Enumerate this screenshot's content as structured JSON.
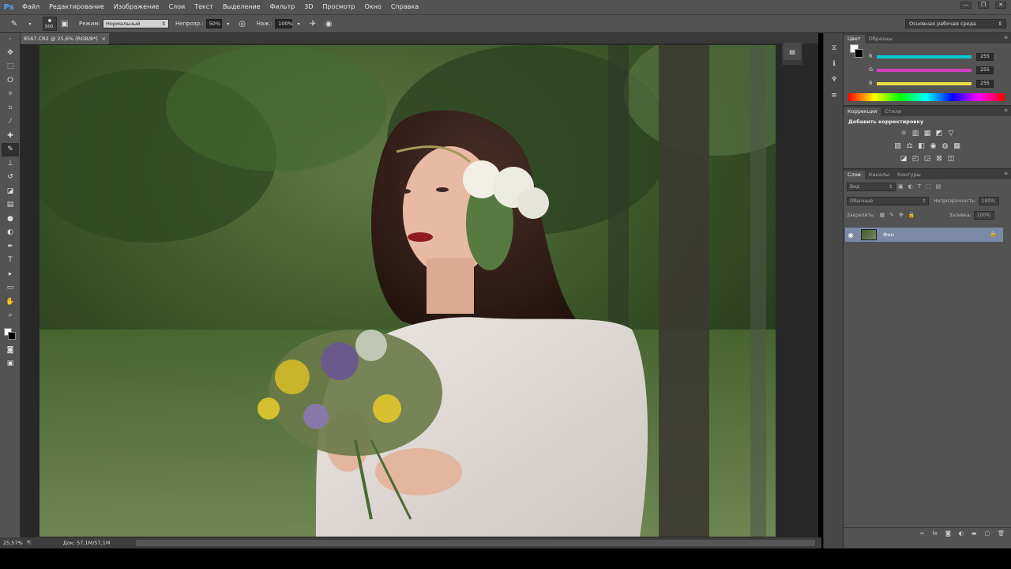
{
  "app": {
    "logo": "Ps"
  },
  "menu": [
    "Файл",
    "Редактирование",
    "Изображение",
    "Слои",
    "Текст",
    "Выделение",
    "Фильтр",
    "3D",
    "Просмотр",
    "Окно",
    "Справка"
  ],
  "window_controls": {
    "minimize": "—",
    "restore": "❐",
    "close": "✕"
  },
  "options_bar": {
    "brush_size": "900",
    "mode_label": "Режим:",
    "mode_value": "Нормальный",
    "opacity_label": "Непрозр.:",
    "opacity_value": "50%",
    "flow_label": "Наж.:",
    "flow_value": "100%",
    "workspace": "Основная рабочая среда"
  },
  "document": {
    "tab_label": "8567.CR2 @ 25,6% (RGB/8*)",
    "close": "×"
  },
  "status": {
    "zoom": "25,57%",
    "doc_size": "Док: 57,1M/57,1M",
    "arrow": "▶"
  },
  "tools": [
    {
      "name": "move-tool",
      "glyph": "✥"
    },
    {
      "name": "marquee-tool",
      "glyph": "⬚"
    },
    {
      "name": "lasso-tool",
      "glyph": "ⵔ"
    },
    {
      "name": "quick-select-tool",
      "glyph": "✧"
    },
    {
      "name": "crop-tool",
      "glyph": "⌗"
    },
    {
      "name": "eyedropper-tool",
      "glyph": "⁄"
    },
    {
      "name": "healing-tool",
      "glyph": "✚"
    },
    {
      "name": "brush-tool",
      "glyph": "✎"
    },
    {
      "name": "stamp-tool",
      "glyph": "⊥"
    },
    {
      "name": "history-brush-tool",
      "glyph": "↺"
    },
    {
      "name": "eraser-tool",
      "glyph": "◪"
    },
    {
      "name": "gradient-tool",
      "glyph": "▤"
    },
    {
      "name": "blur-tool",
      "glyph": "●"
    },
    {
      "name": "dodge-tool",
      "glyph": "◐"
    },
    {
      "name": "pen-tool",
      "glyph": "✒"
    },
    {
      "name": "type-tool",
      "glyph": "T"
    },
    {
      "name": "path-select-tool",
      "glyph": "▸"
    },
    {
      "name": "shape-tool",
      "glyph": "▭"
    },
    {
      "name": "hand-tool",
      "glyph": "✋"
    },
    {
      "name": "zoom-tool",
      "glyph": "⌕"
    }
  ],
  "color_panel": {
    "tabs": [
      "Цвет",
      "Образцы"
    ],
    "channels": [
      {
        "label": "R",
        "value": "255",
        "color": "#00c8d0"
      },
      {
        "label": "G",
        "value": "255",
        "color": "#d040c0"
      },
      {
        "label": "B",
        "value": "255",
        "color": "#e8e040"
      }
    ]
  },
  "adjustments_panel": {
    "tabs": [
      "Коррекция",
      "Стили"
    ],
    "title": "Добавить корректировку",
    "row1": [
      "☼",
      "▥",
      "▦",
      "◩",
      "▽"
    ],
    "row2": [
      "▨",
      "⚖",
      "◧",
      "◉",
      "◍",
      "▦"
    ],
    "row3": [
      "◪",
      "◰",
      "◲",
      "⊠",
      "◫"
    ]
  },
  "layers_panel": {
    "tabs": [
      "Слои",
      "Каналы",
      "Контуры"
    ],
    "kind_filter": "Вид",
    "blend_mode": "Обычные",
    "opacity_label": "Непрозрачность:",
    "opacity_value": "100%",
    "lock_label": "Закрепить:",
    "fill_label": "Заливка:",
    "fill_value": "100%",
    "layer_name": "Фон"
  },
  "colors": {
    "ui_bg": "#535353",
    "canvas_bg": "#282828",
    "layer_selected": "#7a8aa6",
    "ps_blue": "#4da4f3"
  }
}
